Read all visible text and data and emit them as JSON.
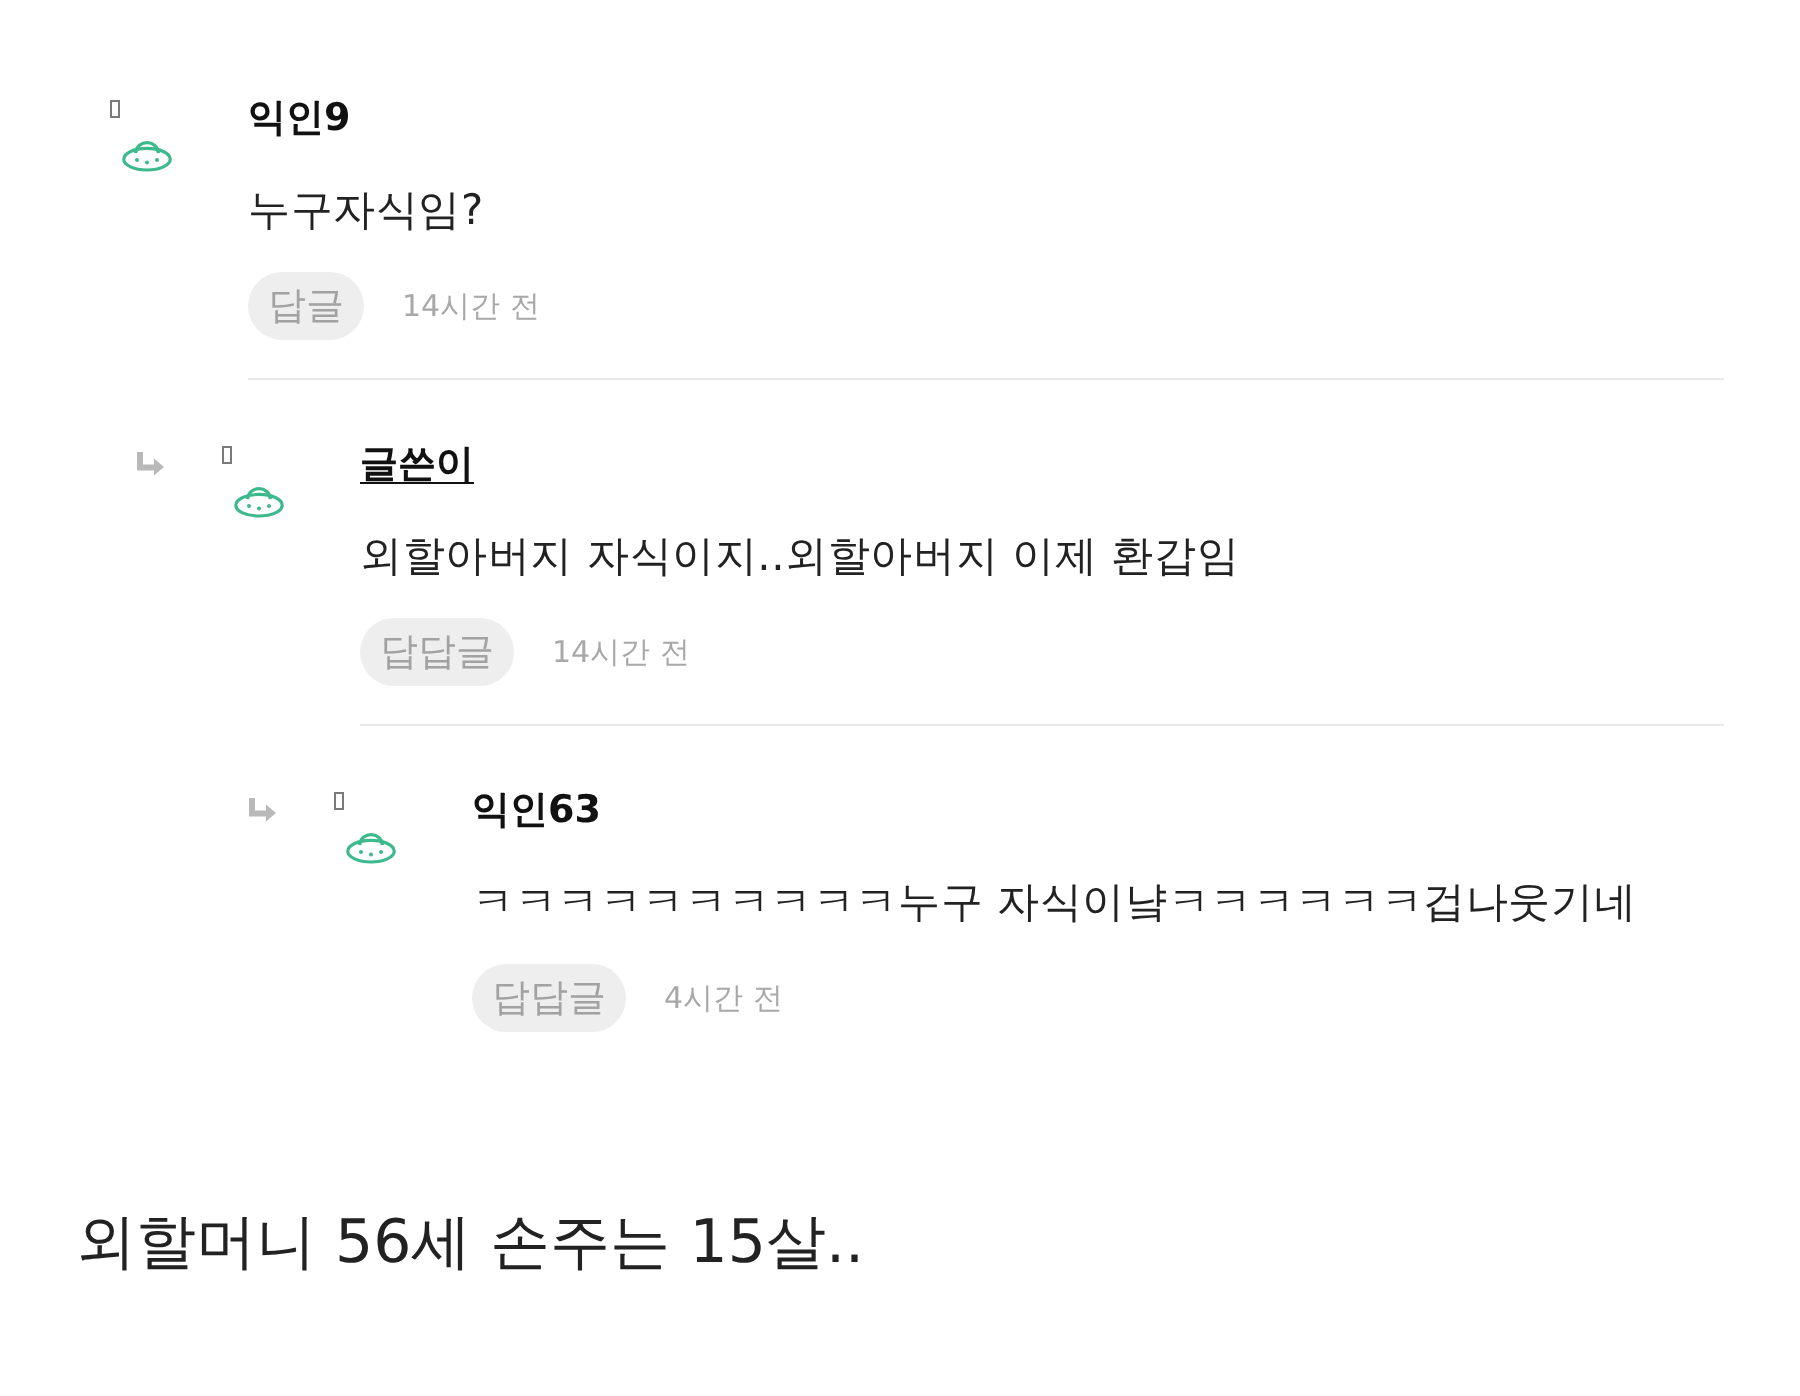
{
  "comments": [
    {
      "author": "익인9",
      "is_writer": false,
      "text": "누구자식임?",
      "reply_button": "답글",
      "time": "14시간 전",
      "children": [
        {
          "author": "글쓴이",
          "is_writer": true,
          "text": "외할아버지 자식이지..외할아버지 이제 환갑임",
          "reply_button": "답답글",
          "time": "14시간 전",
          "children": [
            {
              "author": "익인63",
              "is_writer": false,
              "text": "ㅋㅋㅋㅋㅋㅋㅋㅋㅋㅋ누구 자식이냨ㅋㅋㅋㅋㅋㅋ겁나웃기네",
              "reply_button": "답답글",
              "time": "4시간 전"
            }
          ]
        }
      ]
    }
  ],
  "caption": "외할머니 56세 손주는 15살.."
}
